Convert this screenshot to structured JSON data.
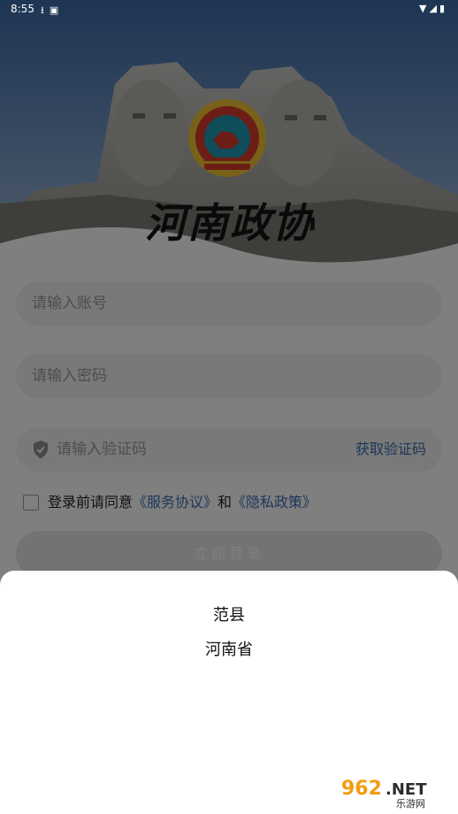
{
  "status_bar": {
    "time": "8:55",
    "left_icons": [
      "download-icon",
      "notification-icon"
    ],
    "right_icons": [
      "wifi-icon",
      "signal-icon",
      "battery-icon"
    ]
  },
  "header": {
    "app_title": "河南政协"
  },
  "form": {
    "account_placeholder": "请输入账号",
    "password_placeholder": "请输入密码",
    "captcha_placeholder": "请输入验证码",
    "get_code_label": "获取验证码",
    "agree_prefix": "登录前请同意",
    "service_agreement": "《服务协议》",
    "agree_and": "和",
    "privacy_policy": "《隐私政策》",
    "login_label": "立即登录"
  },
  "sheet": {
    "items": [
      {
        "label": "范县"
      },
      {
        "label": "河南省"
      }
    ]
  },
  "watermark": {
    "brand": "962.NET",
    "sub": "乐游网"
  },
  "colors": {
    "link": "#3a6fb3",
    "field_bg": "#f3f3f3",
    "overlay": "rgba(0,0,0,0.5)"
  }
}
